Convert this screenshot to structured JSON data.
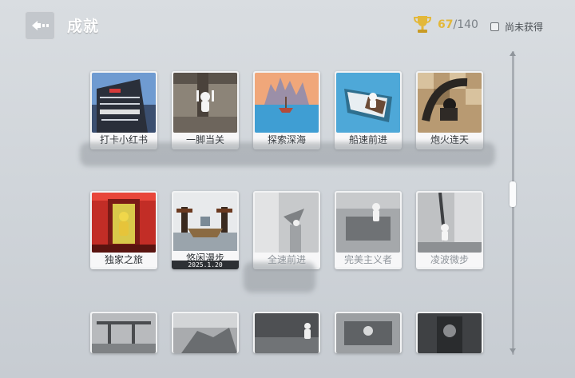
{
  "header": {
    "title": "成就",
    "earned": "67",
    "total": "/140",
    "filter_label": "尚未获得"
  },
  "achievements": [
    {
      "label": "打卡小红书",
      "state": "color"
    },
    {
      "label": "一脚当关",
      "state": "color"
    },
    {
      "label": "探索深海",
      "state": "color"
    },
    {
      "label": "船速前进",
      "state": "color"
    },
    {
      "label": "炮火连天",
      "state": "color"
    },
    {
      "label": "独家之旅",
      "state": "color"
    },
    {
      "label": "悠闲漫步",
      "state": "color",
      "date": "2025.1.20"
    },
    {
      "label": "全速前进",
      "state": "gray"
    },
    {
      "label": "完美主义者",
      "state": "gray"
    },
    {
      "label": "凌波微步",
      "state": "gray"
    }
  ],
  "colors": {
    "gold": "#e3b83a",
    "card_label_gray": "#8f959b",
    "date_bar": "#2d3034"
  },
  "icons": [
    "back-arrow-icon",
    "trophy-icon",
    "checkbox-icon"
  ]
}
